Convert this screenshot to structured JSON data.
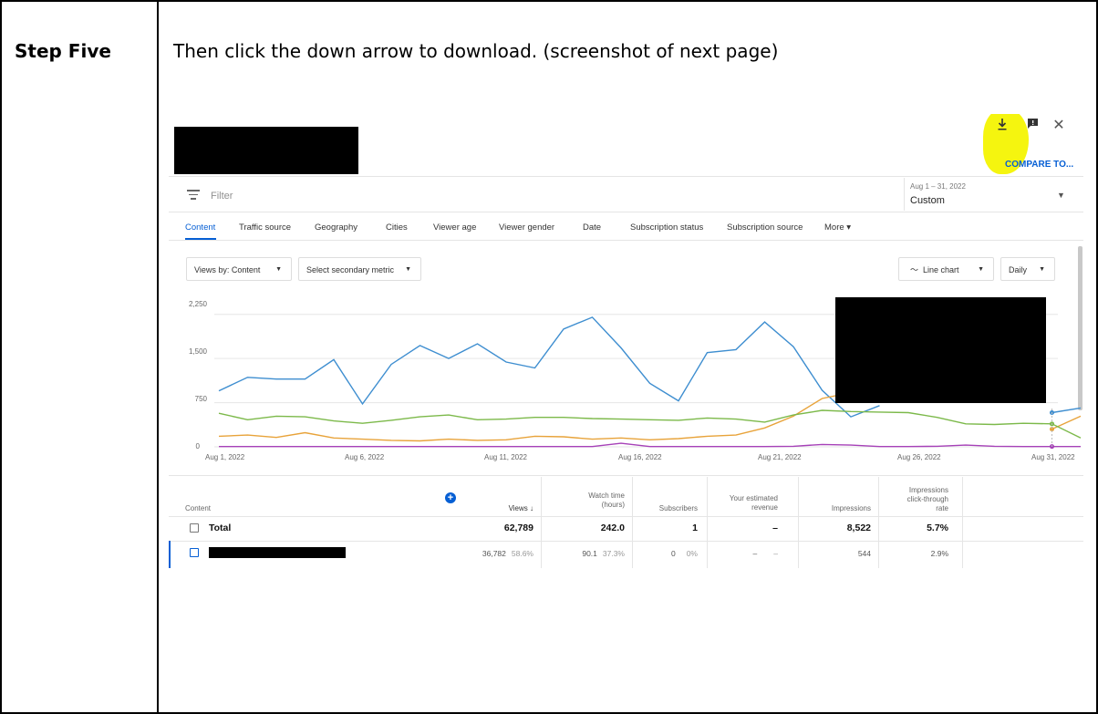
{
  "document": {
    "step_label": "Step Five",
    "step_text": "Then click the down arrow to download. (screenshot of next page)"
  },
  "screenshot": {
    "header": {
      "download_icon": "download-icon",
      "feedback_icon": "feedback-icon",
      "close_icon": "close-icon",
      "compare_label": "COMPARE TO...",
      "highlight_color": "#f5f50f"
    },
    "filter": {
      "placeholder": "Filter",
      "date_range": "Aug 1 – 31, 2022",
      "date_preset": "Custom"
    },
    "tabs": [
      "Content",
      "Traffic source",
      "Geography",
      "Cities",
      "Viewer age",
      "Viewer gender",
      "Date",
      "Subscription status",
      "Subscription source",
      "More ▾"
    ],
    "controls": {
      "views_by": "Views by: Content",
      "secondary_metric": "Select secondary metric",
      "chart_type": "Line chart",
      "interval": "Daily"
    },
    "table": {
      "headers": {
        "content": "Content",
        "views": "Views ↓",
        "watch_time_1": "Watch time",
        "watch_time_2": "(hours)",
        "subscribers": "Subscribers",
        "revenue_1": "Your estimated",
        "revenue_2": "revenue",
        "impressions": "Impressions",
        "ctr_1": "Impressions",
        "ctr_2": "click-through",
        "ctr_3": "rate"
      },
      "total": {
        "label": "Total",
        "views": "62,789",
        "watch_time": "242.0",
        "subscribers": "1",
        "revenue": "–",
        "impressions": "8,522",
        "ctr": "5.7%"
      },
      "row": {
        "views": "36,782",
        "views_pct": "58.6%",
        "watch_time": "90.1",
        "watch_pct": "37.3%",
        "subscribers": "0",
        "subscribers_pct": "0%",
        "revenue": "–",
        "revenue_pct": "–",
        "impressions": "544",
        "ctr": "2.9%"
      }
    }
  },
  "chart_data": {
    "type": "line",
    "title": "",
    "xlabel": "",
    "ylabel": "",
    "x_tick_labels": [
      "Aug 1, 2022",
      "Aug 6, 2022",
      "Aug 11, 2022",
      "Aug 16, 2022",
      "Aug 21, 2022",
      "Aug 26, 2022",
      "Aug 31, 2022"
    ],
    "y_tick_labels": [
      "2,250",
      "1,500",
      "750",
      "0"
    ],
    "ylim": [
      0,
      2400
    ],
    "x": [
      1,
      2,
      3,
      4,
      5,
      6,
      7,
      8,
      9,
      10,
      11,
      12,
      13,
      14,
      15,
      16,
      17,
      18,
      19,
      20,
      21,
      22,
      23,
      24,
      25,
      26,
      27,
      28,
      29,
      30,
      31
    ],
    "grid": true,
    "series": [
      {
        "color": "#3e8ed0",
        "values": [
          950,
          1180,
          1150,
          1150,
          1480,
          730,
          1400,
          1720,
          1500,
          1750,
          1440,
          1340,
          2000,
          2200,
          1680,
          1080,
          780,
          1600,
          1650,
          2120,
          1700,
          960,
          510,
          700,
          null,
          null,
          null,
          null,
          null,
          580,
          660
        ]
      },
      {
        "color": "#e8a33a",
        "values": [
          180,
          200,
          160,
          240,
          150,
          130,
          110,
          100,
          130,
          110,
          120,
          180,
          170,
          130,
          150,
          120,
          140,
          180,
          200,
          320,
          520,
          820,
          920,
          null,
          null,
          null,
          null,
          null,
          null,
          300,
          520
        ]
      },
      {
        "color": "#7cb94a",
        "values": [
          570,
          460,
          520,
          510,
          440,
          400,
          450,
          510,
          540,
          460,
          470,
          500,
          500,
          480,
          470,
          460,
          450,
          490,
          470,
          420,
          540,
          620,
          600,
          590,
          580,
          500,
          390,
          380,
          400,
          390,
          150
        ]
      },
      {
        "color": "#a641b8",
        "values": [
          5,
          5,
          5,
          5,
          5,
          5,
          5,
          5,
          5,
          5,
          5,
          5,
          5,
          5,
          60,
          5,
          5,
          5,
          5,
          5,
          10,
          40,
          30,
          5,
          5,
          10,
          30,
          10,
          5,
          5,
          5
        ]
      }
    ]
  }
}
